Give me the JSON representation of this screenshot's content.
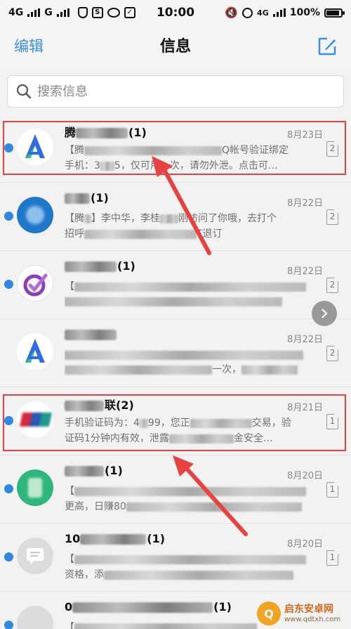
{
  "status_bar": {
    "network1": "4G",
    "network2": "G",
    "time": "10:00",
    "network3": "4G",
    "battery": "100%"
  },
  "header": {
    "edit_label": "编辑",
    "title": "信息",
    "compose_icon": "compose-icon"
  },
  "search": {
    "placeholder": "搜索信息"
  },
  "messages": [
    {
      "sender_prefix": "腾",
      "sender_suffix": "(1)",
      "date": "8月23日",
      "sim": "2",
      "avatar": "app-a-logo",
      "line1_prefix": "【腾",
      "line1_suffix": "Q帐号验证绑定",
      "line2_prefix": "手机：3",
      "line2_suffix": "5，仅可用一次，请勿外泄。点击可…"
    },
    {
      "sender_prefix": "",
      "sender_suffix": "(1)",
      "date": "8月22日",
      "sim": "2",
      "avatar": "blue-circle-logo",
      "line1_prefix": "【腾",
      "line1_suffix": "】李中华，李桂",
      "line1_tail": "刚访问了你哦，去打个",
      "line2_prefix": "招呼",
      "line2_suffix": "T退订"
    },
    {
      "sender_prefix": "",
      "sender_suffix": "(1)",
      "date": "8月22日",
      "sim": "2",
      "avatar": "purple-check-logo",
      "line1_prefix": "【",
      "line1_suffix": "",
      "line2_prefix": "",
      "line2_suffix": ""
    },
    {
      "sender_prefix": "",
      "sender_suffix": "",
      "date": "8月22日",
      "sim": "2",
      "avatar": "app-a-logo",
      "line1_prefix": "",
      "line1_suffix": "",
      "line2_prefix": "",
      "line2_suffix": "一次，"
    },
    {
      "sender_prefix": "",
      "sender_suffix": "联(2)",
      "date": "8月21日",
      "sim": "1",
      "avatar": "bank-card-logo",
      "line1_prefix": "手机验证码为：4",
      "line1_suffix": "99，您正",
      "line1_tail": "交易，验",
      "line2_prefix": "证码1分钟内有效，泄露",
      "line2_suffix": "金安全…"
    },
    {
      "sender_prefix": "",
      "sender_suffix": "(1)",
      "date": "8月20日",
      "sim": "1",
      "avatar": "green-robot-logo",
      "line1_prefix": "【",
      "line1_suffix": "",
      "line2_prefix": "更高，日赚80",
      "line2_suffix": ""
    },
    {
      "sender_prefix": "10",
      "sender_suffix": "(1)",
      "date": "8月20日",
      "sim": "1",
      "avatar": "chat-bubble-logo",
      "line1_prefix": "【",
      "line1_suffix": "",
      "line2_prefix": "资格，添",
      "line2_suffix": ""
    },
    {
      "sender_prefix": "0",
      "sender_suffix": "(1)",
      "date": "",
      "sim": "",
      "avatar": "grey-circle-logo",
      "line1_prefix": "【",
      "line1_suffix": "",
      "line2_prefix": "",
      "line2_suffix": ""
    }
  ],
  "watermark": {
    "title": "启东安卓网",
    "url": "www.qdtxh.com"
  },
  "colors": {
    "accent": "#3a8ee6",
    "unread_dot": "#2f89e3",
    "highlight": "#e8413f"
  }
}
